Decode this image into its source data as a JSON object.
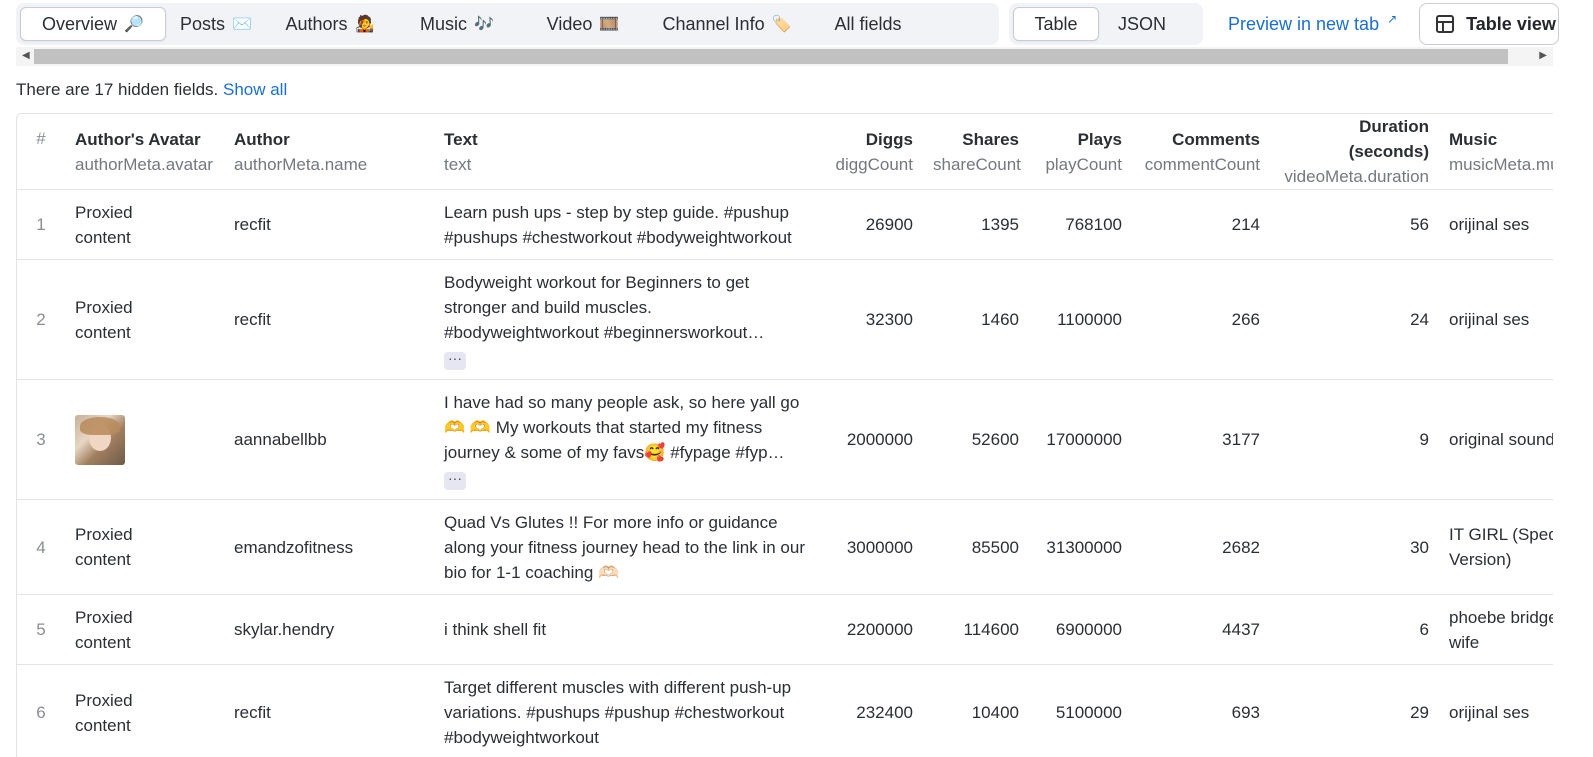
{
  "tabs": [
    {
      "label": "Overview",
      "emoji": "🔎"
    },
    {
      "label": "Posts",
      "emoji": "✉️"
    },
    {
      "label": "Authors",
      "emoji": "🧑‍🎤"
    },
    {
      "label": "Music",
      "emoji": "🎶"
    },
    {
      "label": "Video",
      "emoji": "🎞️"
    },
    {
      "label": "Channel Info",
      "emoji": "🏷️"
    },
    {
      "label": "All fields",
      "emoji": ""
    }
  ],
  "view_tabs": [
    "Table",
    "JSON"
  ],
  "preview_link": "Preview in new tab",
  "preview_icon": "↗",
  "table_view_button": "Table view",
  "notice": {
    "text": "There are 17 hidden fields.",
    "link": "Show all"
  },
  "columns": [
    {
      "label": "#",
      "field": ""
    },
    {
      "label": "Author's Avatar",
      "field": "authorMeta.avatar"
    },
    {
      "label": "Author",
      "field": "authorMeta.name"
    },
    {
      "label": "Text",
      "field": "text"
    },
    {
      "label": "Diggs",
      "field": "diggCount"
    },
    {
      "label": "Shares",
      "field": "shareCount"
    },
    {
      "label": "Plays",
      "field": "playCount"
    },
    {
      "label": "Comments",
      "field": "commentCount"
    },
    {
      "label": "Duration (seconds)",
      "field": "videoMeta.duration"
    },
    {
      "label": "Music",
      "field": "musicMeta.musicName"
    }
  ],
  "rows": [
    {
      "idx": "1",
      "avatar": "Proxied content",
      "author": "recfit",
      "text": "Learn push ups - step by step guide. #pushup #pushups #chestworkout #bodyweightworkout",
      "more": "",
      "diggs": "26900",
      "shares": "1395",
      "plays": "768100",
      "comments": "214",
      "duration": "56",
      "music": "orijinal ses"
    },
    {
      "idx": "2",
      "avatar": "Proxied content",
      "author": "recfit",
      "text": "Bodyweight workout for Beginners to get stronger and build muscles. #bodyweightworkout #beginnersworkout…",
      "more": "···",
      "diggs": "32300",
      "shares": "1460",
      "plays": "1100000",
      "comments": "266",
      "duration": "24",
      "music": "orijinal ses"
    },
    {
      "idx": "3",
      "avatar": "",
      "author": "aannabellbb",
      "text": "I have had so many people ask, so here yall go 🫶 🫶  My workouts that started my fitness journey & some of my favs🥰 #fypage #fyp…",
      "more": "···",
      "diggs": "2000000",
      "shares": "52600",
      "plays": "17000000",
      "comments": "3177",
      "duration": "9",
      "music": "original sound"
    },
    {
      "idx": "4",
      "avatar": "Proxied content",
      "author": "emandzofitness",
      "text": "Quad Vs Glutes !! For more info or guidance along your fitness journey head to the link in our bio for 1-1 coaching 🫶🏻",
      "more": "",
      "diggs": "3000000",
      "shares": "85500",
      "plays": "31300000",
      "comments": "2682",
      "duration": "30",
      "music": "IT GIRL (Sped up Version)"
    },
    {
      "idx": "5",
      "avatar": "Proxied content",
      "author": "skylar.hendry",
      "text": "i think shell fit",
      "more": "",
      "diggs": "2200000",
      "shares": "114600",
      "plays": "6900000",
      "comments": "4437",
      "duration": "6",
      "music": "phoebe bridgers wife"
    },
    {
      "idx": "6",
      "avatar": "Proxied content",
      "author": "recfit",
      "text": "Target different muscles with different push-up variations. #pushups #pushup #chestworkout #bodyweightworkout",
      "more": "",
      "diggs": "232400",
      "shares": "10400",
      "plays": "5100000",
      "comments": "693",
      "duration": "29",
      "music": "orijinal ses"
    }
  ]
}
